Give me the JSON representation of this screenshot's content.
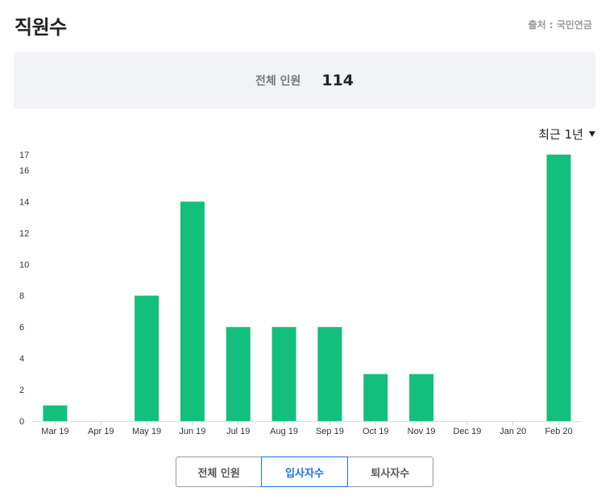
{
  "header": {
    "title": "직원수",
    "source": "출처 : 국민연금"
  },
  "summary": {
    "label": "전체 인원",
    "value": "114"
  },
  "period": {
    "label": "최근 1년"
  },
  "tabs": [
    {
      "label": "전체 인원",
      "active": false
    },
    {
      "label": "입사자수",
      "active": true
    },
    {
      "label": "퇴사자수",
      "active": false
    }
  ],
  "colors": {
    "bar": "#13bf7c",
    "active_tab": "#1a73e8"
  },
  "chart_data": {
    "type": "bar",
    "categories": [
      "Mar 19",
      "Apr 19",
      "May 19",
      "Jun 19",
      "Jul 19",
      "Aug 19",
      "Sep 19",
      "Oct 19",
      "Nov 19",
      "Dec 19",
      "Jan 20",
      "Feb 20"
    ],
    "values": [
      1,
      0,
      8,
      14,
      6,
      6,
      6,
      3,
      3,
      0,
      0,
      17
    ],
    "yticks": [
      0,
      2,
      4,
      6,
      8,
      10,
      12,
      14,
      16,
      17
    ],
    "ylim": [
      0,
      17
    ],
    "grid": false
  }
}
